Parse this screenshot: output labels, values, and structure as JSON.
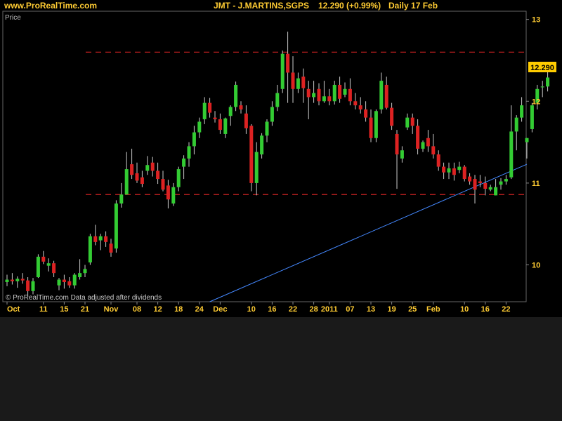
{
  "header": {
    "site": "www.ProRealTime.com",
    "ticker": "JMT - J.MARTINS,SGPS",
    "quote": "12.290 (+0.99%)",
    "period": "Daily 17 Feb"
  },
  "panel": {
    "price_label": "Price",
    "footnote": "© ProRealTime.com  Data adjusted after dividends",
    "last_price_tag": "12.290"
  },
  "colors": {
    "background": "#000000",
    "bull": "#33cc33",
    "bear": "#dd2222",
    "wick": "#cccccc",
    "support": "#cc2222",
    "trendline": "#4488ff",
    "text": "#ffcc33",
    "price_tag_bg": "#ffcc00",
    "lower_area": "#1a1a1a"
  },
  "chart_data": {
    "type": "candlestick",
    "title": "JMT - J.MARTINS,SGPS",
    "ylim": [
      9.55,
      13.1
    ],
    "y_ticks": [
      10,
      11,
      12,
      13
    ],
    "x_tick_labels": [
      {
        "i": 0,
        "label": "Oct",
        "month": true
      },
      {
        "i": 7,
        "label": "11"
      },
      {
        "i": 11,
        "label": "15"
      },
      {
        "i": 15,
        "label": "21"
      },
      {
        "i": 20,
        "label": "Nov",
        "month": true
      },
      {
        "i": 25,
        "label": "08"
      },
      {
        "i": 29,
        "label": "12"
      },
      {
        "i": 33,
        "label": "18"
      },
      {
        "i": 37,
        "label": "24"
      },
      {
        "i": 41,
        "label": "Dec",
        "month": true
      },
      {
        "i": 47,
        "label": "10"
      },
      {
        "i": 51,
        "label": "16"
      },
      {
        "i": 55,
        "label": "22"
      },
      {
        "i": 59,
        "label": "28"
      },
      {
        "i": 62,
        "label": "2011",
        "month": true
      },
      {
        "i": 66,
        "label": "07"
      },
      {
        "i": 70,
        "label": "13"
      },
      {
        "i": 74,
        "label": "19"
      },
      {
        "i": 78,
        "label": "25"
      },
      {
        "i": 82,
        "label": "Feb",
        "month": true
      },
      {
        "i": 88,
        "label": "10"
      },
      {
        "i": 92,
        "label": "16"
      },
      {
        "i": 96,
        "label": "22"
      }
    ],
    "support_levels": [
      12.6,
      10.86
    ],
    "trendline": [
      {
        "i": 39,
        "y": 9.55
      },
      {
        "i": 100,
        "y": 11.23
      }
    ],
    "last_price": 12.29,
    "ohlc": [
      [
        9.79,
        9.88,
        9.74,
        9.82
      ],
      [
        9.82,
        9.9,
        9.76,
        9.8
      ],
      [
        9.8,
        9.86,
        9.72,
        9.83
      ],
      [
        9.83,
        9.9,
        9.77,
        9.81
      ],
      [
        9.81,
        9.85,
        9.63,
        9.68
      ],
      [
        9.68,
        9.84,
        9.64,
        9.8
      ],
      [
        9.85,
        10.13,
        9.84,
        10.1
      ],
      [
        10.1,
        10.17,
        10.01,
        10.04
      ],
      [
        9.99,
        10.08,
        9.92,
        10.02
      ],
      [
        10.02,
        10.05,
        9.85,
        9.9
      ],
      [
        9.75,
        9.84,
        9.69,
        9.82
      ],
      [
        9.82,
        9.88,
        9.71,
        9.79
      ],
      [
        9.8,
        9.85,
        9.72,
        9.75
      ],
      [
        9.75,
        9.9,
        9.71,
        9.88
      ],
      [
        9.85,
        10.07,
        9.82,
        9.9
      ],
      [
        9.9,
        10.0,
        9.85,
        9.95
      ],
      [
        10.03,
        10.38,
        10.0,
        10.35
      ],
      [
        10.35,
        10.49,
        10.24,
        10.28
      ],
      [
        10.3,
        10.38,
        10.18,
        10.35
      ],
      [
        10.35,
        10.41,
        10.22,
        10.28
      ],
      [
        10.26,
        10.32,
        10.1,
        10.15
      ],
      [
        10.2,
        10.79,
        10.15,
        10.75
      ],
      [
        10.75,
        11.0,
        10.7,
        10.86
      ],
      [
        10.86,
        11.38,
        10.86,
        11.17
      ],
      [
        11.23,
        11.42,
        11.05,
        11.1
      ],
      [
        11.12,
        11.25,
        11.0,
        11.03
      ],
      [
        11.07,
        11.15,
        10.95,
        10.99
      ],
      [
        11.15,
        11.33,
        11.1,
        11.22
      ],
      [
        11.25,
        11.32,
        11.08,
        11.15
      ],
      [
        11.15,
        11.25,
        10.99,
        11.05
      ],
      [
        11.05,
        11.15,
        10.9,
        10.92
      ],
      [
        10.97,
        11.04,
        10.69,
        10.8
      ],
      [
        10.75,
        11.0,
        10.72,
        10.95
      ],
      [
        10.95,
        11.2,
        10.9,
        11.17
      ],
      [
        11.2,
        11.34,
        11.05,
        11.3
      ],
      [
        11.3,
        11.5,
        11.2,
        11.45
      ],
      [
        11.45,
        11.7,
        11.35,
        11.62
      ],
      [
        11.62,
        11.8,
        11.55,
        11.75
      ],
      [
        11.78,
        12.05,
        11.72,
        11.98
      ],
      [
        11.98,
        12.04,
        11.8,
        11.86
      ],
      [
        11.8,
        11.88,
        11.74,
        11.78
      ],
      [
        11.78,
        11.85,
        11.6,
        11.65
      ],
      [
        11.6,
        11.8,
        11.55,
        11.79
      ],
      [
        11.82,
        11.95,
        11.7,
        11.93
      ],
      [
        11.93,
        12.24,
        11.88,
        12.2
      ],
      [
        11.95,
        12.0,
        11.85,
        11.9
      ],
      [
        11.85,
        11.95,
        11.6,
        11.67
      ],
      [
        11.7,
        11.72,
        10.9,
        11.0
      ],
      [
        11.0,
        11.5,
        10.85,
        11.38
      ],
      [
        11.35,
        11.61,
        11.3,
        11.58
      ],
      [
        11.58,
        11.78,
        11.5,
        11.75
      ],
      [
        11.75,
        12.0,
        11.7,
        11.93
      ],
      [
        11.93,
        12.2,
        11.88,
        12.1
      ],
      [
        12.15,
        12.62,
        12.1,
        12.58
      ],
      [
        12.58,
        12.85,
        11.98,
        12.35
      ],
      [
        12.35,
        12.55,
        11.98,
        12.15
      ],
      [
        12.15,
        12.35,
        12.1,
        12.28
      ],
      [
        12.3,
        12.4,
        11.98,
        12.16
      ],
      [
        12.15,
        12.25,
        11.78,
        12.05
      ],
      [
        12.05,
        12.25,
        11.98,
        12.1
      ],
      [
        12.15,
        12.22,
        11.95,
        12.0
      ],
      [
        12.0,
        12.25,
        11.98,
        12.06
      ],
      [
        12.06,
        12.15,
        11.95,
        12.0
      ],
      [
        12.0,
        12.25,
        11.96,
        12.2
      ],
      [
        12.2,
        12.3,
        11.98,
        12.03
      ],
      [
        12.08,
        12.23,
        12.05,
        12.15
      ],
      [
        12.15,
        12.28,
        11.95,
        12.0
      ],
      [
        12.0,
        12.1,
        11.9,
        11.95
      ],
      [
        11.95,
        12.05,
        11.85,
        11.9
      ],
      [
        11.9,
        12.0,
        11.75,
        11.8
      ],
      [
        11.8,
        11.9,
        11.5,
        11.55
      ],
      [
        11.55,
        11.9,
        11.5,
        11.88
      ],
      [
        11.9,
        12.35,
        11.85,
        12.25
      ],
      [
        12.2,
        12.3,
        11.9,
        11.92
      ],
      [
        11.92,
        11.98,
        11.65,
        11.7
      ],
      [
        11.6,
        11.65,
        10.93,
        11.35
      ],
      [
        11.3,
        11.45,
        11.25,
        11.4
      ],
      [
        11.68,
        11.85,
        11.65,
        11.8
      ],
      [
        11.8,
        11.85,
        11.6,
        11.7
      ],
      [
        11.7,
        11.78,
        11.35,
        11.42
      ],
      [
        11.42,
        11.52,
        11.38,
        11.5
      ],
      [
        11.55,
        11.65,
        11.38,
        11.45
      ],
      [
        11.45,
        11.6,
        11.3,
        11.35
      ],
      [
        11.35,
        11.4,
        11.15,
        11.2
      ],
      [
        11.2,
        11.25,
        11.05,
        11.13
      ],
      [
        11.13,
        11.25,
        11.05,
        11.18
      ],
      [
        11.18,
        11.25,
        11.03,
        11.1
      ],
      [
        11.16,
        11.26,
        11.12,
        11.2
      ],
      [
        11.2,
        11.22,
        11.02,
        11.05
      ],
      [
        11.08,
        11.12,
        10.98,
        11.02
      ],
      [
        11.05,
        11.1,
        10.75,
        10.92
      ],
      [
        11.02,
        11.1,
        10.95,
        11.0
      ],
      [
        11.0,
        11.08,
        10.85,
        10.93
      ],
      [
        10.92,
        10.98,
        10.9,
        10.95
      ],
      [
        10.85,
        11.05,
        10.85,
        10.95
      ],
      [
        10.98,
        11.06,
        10.92,
        11.02
      ],
      [
        11.02,
        11.1,
        10.98,
        11.05
      ],
      [
        11.07,
        11.95,
        11.05,
        11.63
      ],
      [
        11.63,
        11.83,
        11.4,
        11.8
      ],
      [
        11.8,
        12.05,
        11.75,
        11.95
      ],
      [
        11.5,
        11.55,
        11.3,
        11.55
      ],
      [
        11.66,
        11.98,
        11.62,
        11.95
      ],
      [
        11.98,
        12.2,
        11.9,
        12.15
      ],
      [
        12.17,
        12.25,
        12.05,
        12.18
      ],
      [
        12.18,
        12.36,
        12.12,
        12.29
      ]
    ]
  }
}
